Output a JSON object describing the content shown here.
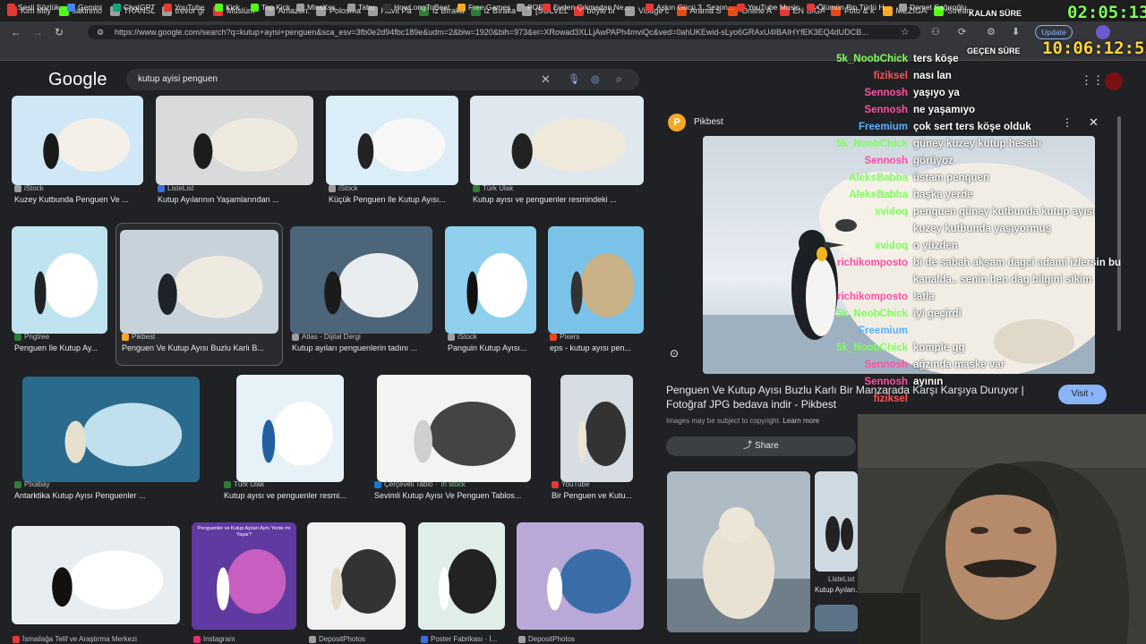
{
  "tabs": [
    {
      "label": "Kim Mily",
      "color": "#e53935"
    },
    {
      "label": "sakinmo",
      "color": "#53fc18"
    },
    {
      "label": "TRANSL",
      "color": "#9e9e9e"
    },
    {
      "label": "trevor gr",
      "color": "#9e9e9e"
    },
    {
      "label": "Müslüm",
      "color": "#e53935"
    },
    {
      "label": "Amazon.",
      "color": "#9e9e9e"
    },
    {
      "label": "Polosma",
      "color": "#9e9e9e"
    },
    {
      "label": "Havit Pa",
      "color": "#9e9e9e"
    },
    {
      "label": "İz Bıraka",
      "color": "#2e7d32"
    },
    {
      "label": "İz Bıraka",
      "color": "#2e7d32"
    },
    {
      "label": "[SOLVED",
      "color": "#9e9e9e"
    },
    {
      "label": "böyle bi",
      "color": "#e53935"
    },
    {
      "label": "Visage c",
      "color": "#9e9e9e"
    },
    {
      "label": "Arama S",
      "color": "#e64a19"
    },
    {
      "label": "Online A",
      "color": "#e64a19"
    },
    {
      "label": "EN SIĞA",
      "color": "#e53935"
    },
    {
      "label": "Foto & k",
      "color": "#e64a19"
    },
    {
      "label": "MEZİGAI",
      "color": "#f9a825"
    },
    {
      "label": "Stream",
      "color": "#53fc18"
    }
  ],
  "url": "https://www.google.com/search?q=kutup+ayisi+penguen&sca_esv=3fb0e2d94fbc189e&udm=2&biw=1920&bih=973&ei=XRowad3XLLjAwPAPh4mviQc&ved=0ahUKEwid-sLyo6GRAxU4IBAIHYfEK3EQ4dUDCB...",
  "update_label": "Update",
  "bookmarks": [
    "Sesli Sözlük",
    "Gemini",
    "ChatGPT",
    "YouTube",
    "Kick",
    "Top Kick",
    "MissXss",
    "Tabu",
    "HowLongToBeat",
    "Free Games",
    "POE",
    "Evden Çıkmadan Ne...",
    "Aşkın Gücü 3. Sezon...",
    "YouTube Music",
    "Ölümün Bin Türlü H...",
    "Demet Sağıroğlu..."
  ],
  "google": {
    "logo": "Google",
    "query": "kutup ayisi penguen"
  },
  "results": [
    {
      "source": "iStock",
      "caption": "Kuzey Kutbunda Penguen Ve ..."
    },
    {
      "source": "ListeList",
      "caption": "Kutup Ayılarının Yaşamlarından ..."
    },
    {
      "source": "iStock",
      "caption": "Küçük Penguen Ile Kutup Ayısı..."
    },
    {
      "source": "Türk Ulak",
      "caption": "Kutup ayısı ve penguenler resmindeki ..."
    },
    {
      "source": "Pngtree",
      "caption": "Penguen Ile Kutup Ay..."
    },
    {
      "source": "Pikbest",
      "caption": "Penguen Ve Kutup Ayısı Buzlu Karlı B..."
    },
    {
      "source": "Atlas - Dijital Dergi",
      "caption": "Kutup ayıları penguenlerin tadını ..."
    },
    {
      "source": "iStock",
      "caption": "Panguin Kutup Ayısı..."
    },
    {
      "source": "Pixers",
      "caption": "eps - kutup ayısı pen..."
    },
    {
      "source": "Pixabay",
      "caption": "Antarktika Kutup Ayısı Penguenler ..."
    },
    {
      "source": "Türk Ulak",
      "caption": "Kutup ayısı ve penguenler resmi..."
    },
    {
      "source": "Çerçeveli Tablo",
      "badge": "In stock",
      "caption": "Sevimli Kutup Ayısı Ve Penguen Tablos..."
    },
    {
      "source": "YouTube",
      "caption": "Bir Penguen ve Kutu..."
    },
    {
      "source": "İsmailağa Telif ve Araştırma Merkezi",
      "caption": ""
    },
    {
      "source": "Instagram",
      "caption": ""
    },
    {
      "source": "DepositPhotos",
      "caption": ""
    },
    {
      "source": "Poster Fabrikası · İ...",
      "caption": ""
    },
    {
      "source": "DepositPhotos",
      "caption": ""
    }
  ],
  "infographic_text": "Penguenler ve Kutup Ayıları Aynı Yerde mi Yaşar?",
  "panel": {
    "source": "Pikbest",
    "title": "Penguen Ve Kutup Ayısı Buzlu Karlı Bir Manzarada Karşı Karşıya Duruyor | Fotoğraf JPG bedava indir - Pikbest",
    "copyright": "Images may be subject to copyright.",
    "learn_more": "Learn more",
    "visit": "Visit",
    "share": "Share",
    "related_source": "ListeList",
    "related_caption": "Kutup Ayıları..."
  },
  "overlay": {
    "remaining_label": "KALAN SÜRE",
    "remaining": "02:05:13:18",
    "elapsed_label": "GEÇEN SÜRE",
    "elapsed": "10:06:12:55"
  },
  "chat": [
    {
      "user": "5k_NoobChick",
      "color": "#7dff5a",
      "msg": "ters köşe"
    },
    {
      "user": "fiziksel",
      "color": "#ff5252",
      "msg": "nası lan"
    },
    {
      "user": "Sennosh",
      "color": "#ff4fa3",
      "msg": "yaşıyo ya"
    },
    {
      "user": "Sennosh",
      "color": "#ff4fa3",
      "msg": "ne yaşamıyo"
    },
    {
      "user": "Freemium",
      "color": "#5ab0ff",
      "msg": "çok sert ters köşe olduk"
    },
    {
      "user": "5k_NoobChick",
      "color": "#7dff5a",
      "msg": "güney kuzey kutup hesabı"
    },
    {
      "user": "Sennosh",
      "color": "#ff4fa3",
      "msg": "görüyoz"
    },
    {
      "user": "AleksBabba",
      "color": "#7dff5a",
      "msg": "üstam penguen"
    },
    {
      "user": "AleksBabba",
      "color": "#7dff5a",
      "msg": "başka yerde"
    },
    {
      "user": "xvidoq",
      "color": "#7dff5a",
      "msg": "penguen güney kutbunda kutup ayısı kuzey kutbunda yaşıyormuş"
    },
    {
      "user": "xvidoq",
      "color": "#7dff5a",
      "msg": "o yüzden"
    },
    {
      "user": "richikomposto",
      "color": "#ff4fa3",
      "msg": "bi de sabah akşam dagci adami izlersin bu kanalda.. senin ben dag bilgini sikim"
    },
    {
      "user": "richikomposto",
      "color": "#ff4fa3",
      "msg": "!atla"
    },
    {
      "user": "5k_NoobChick",
      "color": "#7dff5a",
      "msg": "iyi geçirdi"
    },
    {
      "user": "Freemium",
      "color": "#5ab0ff",
      "msg": ""
    },
    {
      "user": "5k_NoobChick",
      "color": "#7dff5a",
      "msg": "komple gg"
    },
    {
      "user": "Sennosh",
      "color": "#ff4fa3",
      "msg": "ağzında maske var"
    },
    {
      "user": "Sennosh",
      "color": "#ff4fa3",
      "msg": "ayının"
    },
    {
      "user": "fiziksel",
      "color": "#ff5252",
      "msg": ""
    }
  ]
}
